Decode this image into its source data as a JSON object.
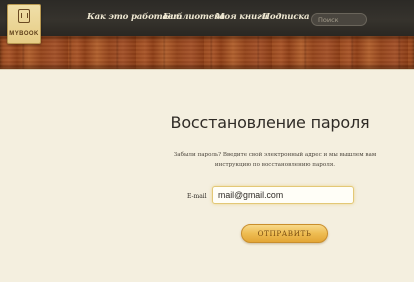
{
  "header": {
    "nav": [
      {
        "label": "Как это работает"
      },
      {
        "label": "Библиотека"
      },
      {
        "label": "Моя книги"
      },
      {
        "label": "Подписка"
      }
    ],
    "search_placeholder": "Поиск"
  },
  "logo": {
    "text": "MYBOOK"
  },
  "main": {
    "title": "Восстановление пароля",
    "description_line1": "Забыли пароль? Введите свой электронный адрес и мы вышлем вам",
    "description_line2": "инструкцию по восстановлению пароля.",
    "email_label": "E-mail",
    "email_value": "mail@gmail.com",
    "submit_label": "ОТПРАВИТЬ"
  },
  "colors": {
    "accent": "#eebc52",
    "topbar": "#2c2a26",
    "wood": "#9b4b20",
    "background": "#f4efdf"
  }
}
